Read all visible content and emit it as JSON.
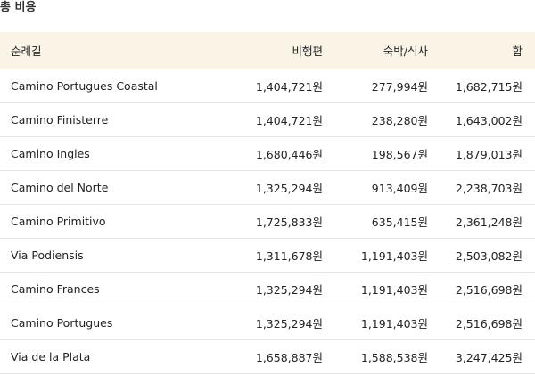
{
  "title": "총 비용",
  "table": {
    "headers": [
      "순례길",
      "비행편",
      "숙박/식사",
      "합"
    ],
    "rows": [
      {
        "route": "Camino Portugues Coastal",
        "flight": "1,404,721원",
        "lodging": "277,994원",
        "total": "1,682,715원"
      },
      {
        "route": "Camino Finisterre",
        "flight": "1,404,721원",
        "lodging": "238,280원",
        "total": "1,643,002원"
      },
      {
        "route": "Camino Ingles",
        "flight": "1,680,446원",
        "lodging": "198,567원",
        "total": "1,879,013원"
      },
      {
        "route": "Camino del Norte",
        "flight": "1,325,294원",
        "lodging": "913,409원",
        "total": "2,238,703원"
      },
      {
        "route": "Camino Primitivo",
        "flight": "1,725,833원",
        "lodging": "635,415원",
        "total": "2,361,248원"
      },
      {
        "route": "Via Podiensis",
        "flight": "1,311,678원",
        "lodging": "1,191,403원",
        "total": "2,503,082원"
      },
      {
        "route": "Camino Frances",
        "flight": "1,325,294원",
        "lodging": "1,191,403원",
        "total": "2,516,698원"
      },
      {
        "route": "Camino Portugues",
        "flight": "1,325,294원",
        "lodging": "1,191,403원",
        "total": "2,516,698원"
      },
      {
        "route": "Via de la Plata",
        "flight": "1,658,887원",
        "lodging": "1,588,538원",
        "total": "3,247,425원"
      }
    ]
  }
}
